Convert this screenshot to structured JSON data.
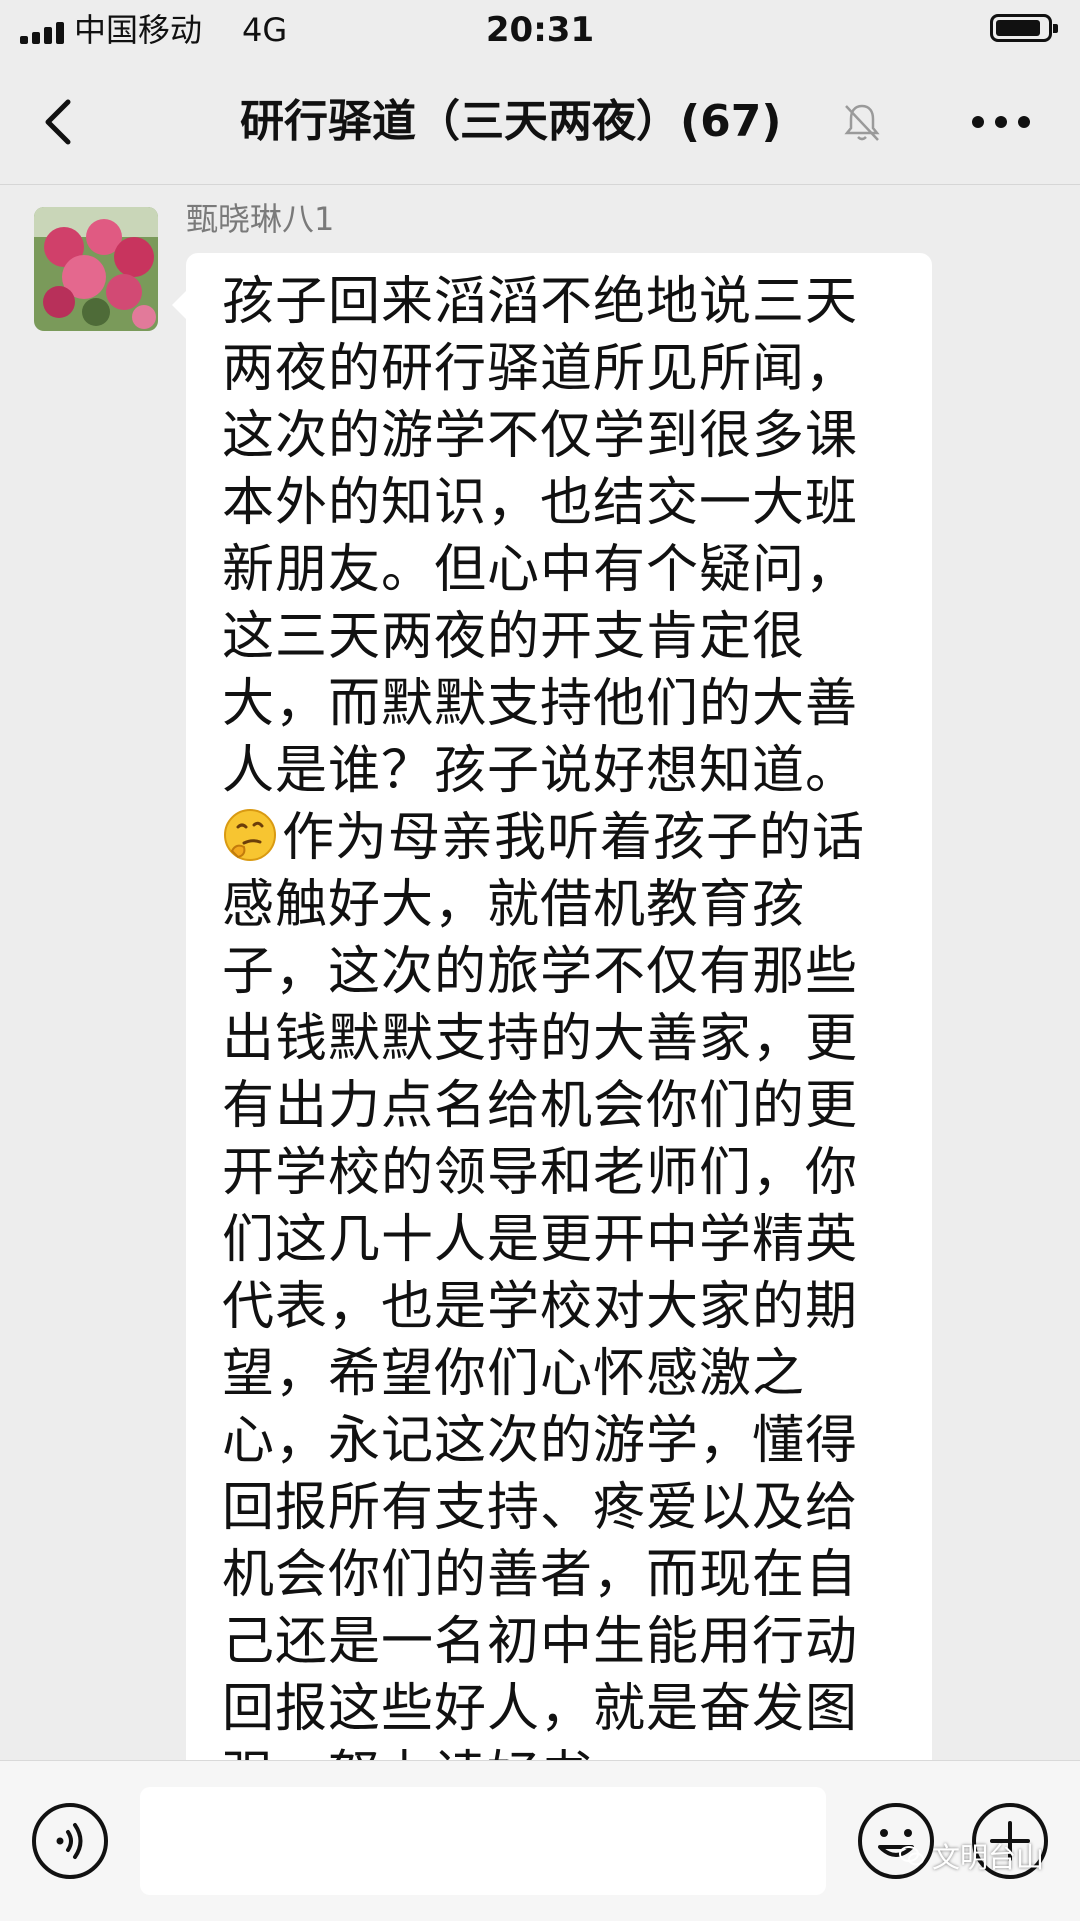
{
  "status_bar": {
    "carrier": "中国移动",
    "network": "4G",
    "time": "20:31"
  },
  "nav": {
    "title": "研行驿道（三天两夜）(67)",
    "back_icon": "chevron-left-icon",
    "mute_icon": "bell-muted-icon",
    "more_icon": "more-dots-icon"
  },
  "message": {
    "sender": "甄晓琳八1",
    "text_before_emoji": "孩子回来滔滔不绝地说三天两夜的研行驿道所见所闻，这次的游学不仅学到很多课本外的知识，也结交一大班新朋友。但心中有个疑问，这三天两夜的开支肯定很大，而默默支持他们的大善人是谁？孩子说好想知道。",
    "emoji": "thinking-face",
    "text_after_emoji": "作为母亲我听着孩子的话感触好大，就借机教育孩子，这次的旅学不仅有那些出钱默默支持的大善家，更有出力点名给机会你们的更开学校的领导和老师们，你们这几十人是更开中学精英代表，也是学校对大家的期望，希望你们心怀感激之心，永记这次的游学，懂得回报所有支持、疼爱以及给机会你们的善者，而现在自己还是一名初中生能用行动回报这些好人，就是奋发图强，努力读好书，..."
  },
  "input_bar": {
    "voice_icon": "voice-icon",
    "emoji_icon": "smiley-icon",
    "plus_icon": "plus-circle-icon"
  },
  "watermark": "文明台山",
  "colors": {
    "background": "#ededed",
    "bubble": "#ffffff",
    "input_bar": "#f6f6f6"
  }
}
